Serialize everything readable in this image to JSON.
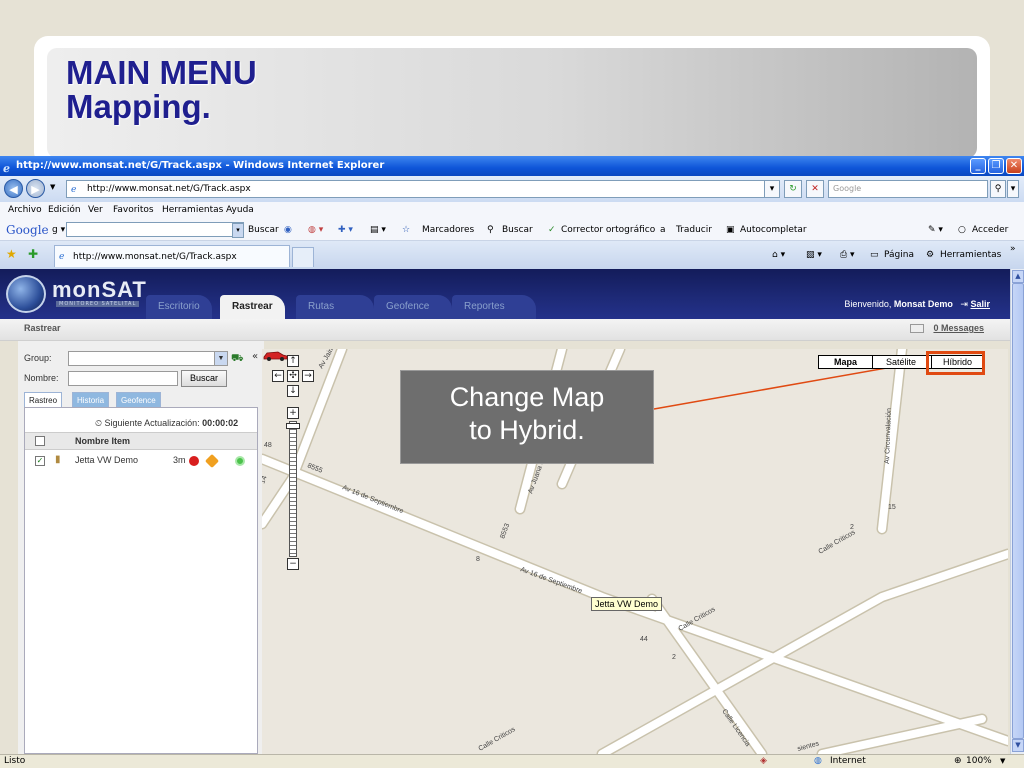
{
  "slide": {
    "title_line1": "MAIN MENU",
    "title_line2": "Mapping."
  },
  "browser": {
    "window_title": "http://www.monsat.net/G/Track.aspx - Windows Internet Explorer",
    "address": "http://www.monsat.net/G/Track.aspx",
    "search_placeholder": "Google",
    "menu": [
      "Archivo",
      "Edición",
      "Ver",
      "Favoritos",
      "Herramientas",
      "Ayuda"
    ],
    "google_toolbar": {
      "logo": "Google",
      "buscar": "Buscar",
      "marcadores": "Marcadores",
      "buscar2": "Buscar",
      "corrector": "Corrector ortográfico",
      "traducir": "Traducir",
      "autocompletar": "Autocompletar",
      "acceder": "Acceder"
    },
    "tab_title": "http://www.monsat.net/G/Track.aspx",
    "commands": {
      "pagina": "Página",
      "herramientas": "Herramientas"
    },
    "status": {
      "left": "Listo",
      "zone": "Internet",
      "zoom": "100%"
    }
  },
  "app": {
    "brand": "monSAT",
    "brand_sub": "MONITOREO SATELITAL",
    "tabs": [
      "Escritorio",
      "Rastrear",
      "Rutas",
      "Geofence",
      "Reportes"
    ],
    "active_tab": "Rastrear",
    "welcome": "Bienvenido,",
    "user": "Monsat Demo",
    "logout": "Salir",
    "section_title": "Rastrear",
    "messages": "0 Messages"
  },
  "panel": {
    "group_label": "Group:",
    "nombre_label": "Nombre:",
    "buscar_button": "Buscar",
    "collapse": "«",
    "tabs": [
      "Rastreo",
      "Historia",
      "Geofence"
    ],
    "next_update_label": "Siguiente Actualización:",
    "next_update_value": "00:00:02",
    "column_header": "Nombre Item",
    "rows": [
      {
        "name": "Jetta VW Demo",
        "distance": "3m",
        "checked": true
      }
    ]
  },
  "map": {
    "types": [
      "Mapa",
      "Satélite",
      "Híbrido"
    ],
    "selected_type": "Mapa",
    "vehicle_label": "Jetta VW Demo",
    "streets": {
      "av_jaime": "Av Jaime",
      "av_juana": "Av Juana de",
      "av_circunvalacion": "Av Circunvalación",
      "av16_a": "Av 16 de Septiembre",
      "av16_b": "Av 16 de Septiembre",
      "calle_criticos_a": "Calle Criticos",
      "calle_criticos_b": "Calle Criticos",
      "calle_criticos_c": "Calle Criticos",
      "calle_licencia": "Calle Licencia",
      "n8555": "8555",
      "n8553": "8553",
      "n44": "44",
      "n2a": "2",
      "n2b": "2",
      "n15": "15",
      "n8": "8",
      "n48": "48",
      "n14": "14",
      "sientes": "sientes"
    }
  },
  "callout": {
    "line1": "Change Map",
    "line2": "to Hybrid."
  },
  "colors": {
    "highlight": "#e04a12",
    "title": "#1f1f8f",
    "app_header": "#1e2a78"
  }
}
